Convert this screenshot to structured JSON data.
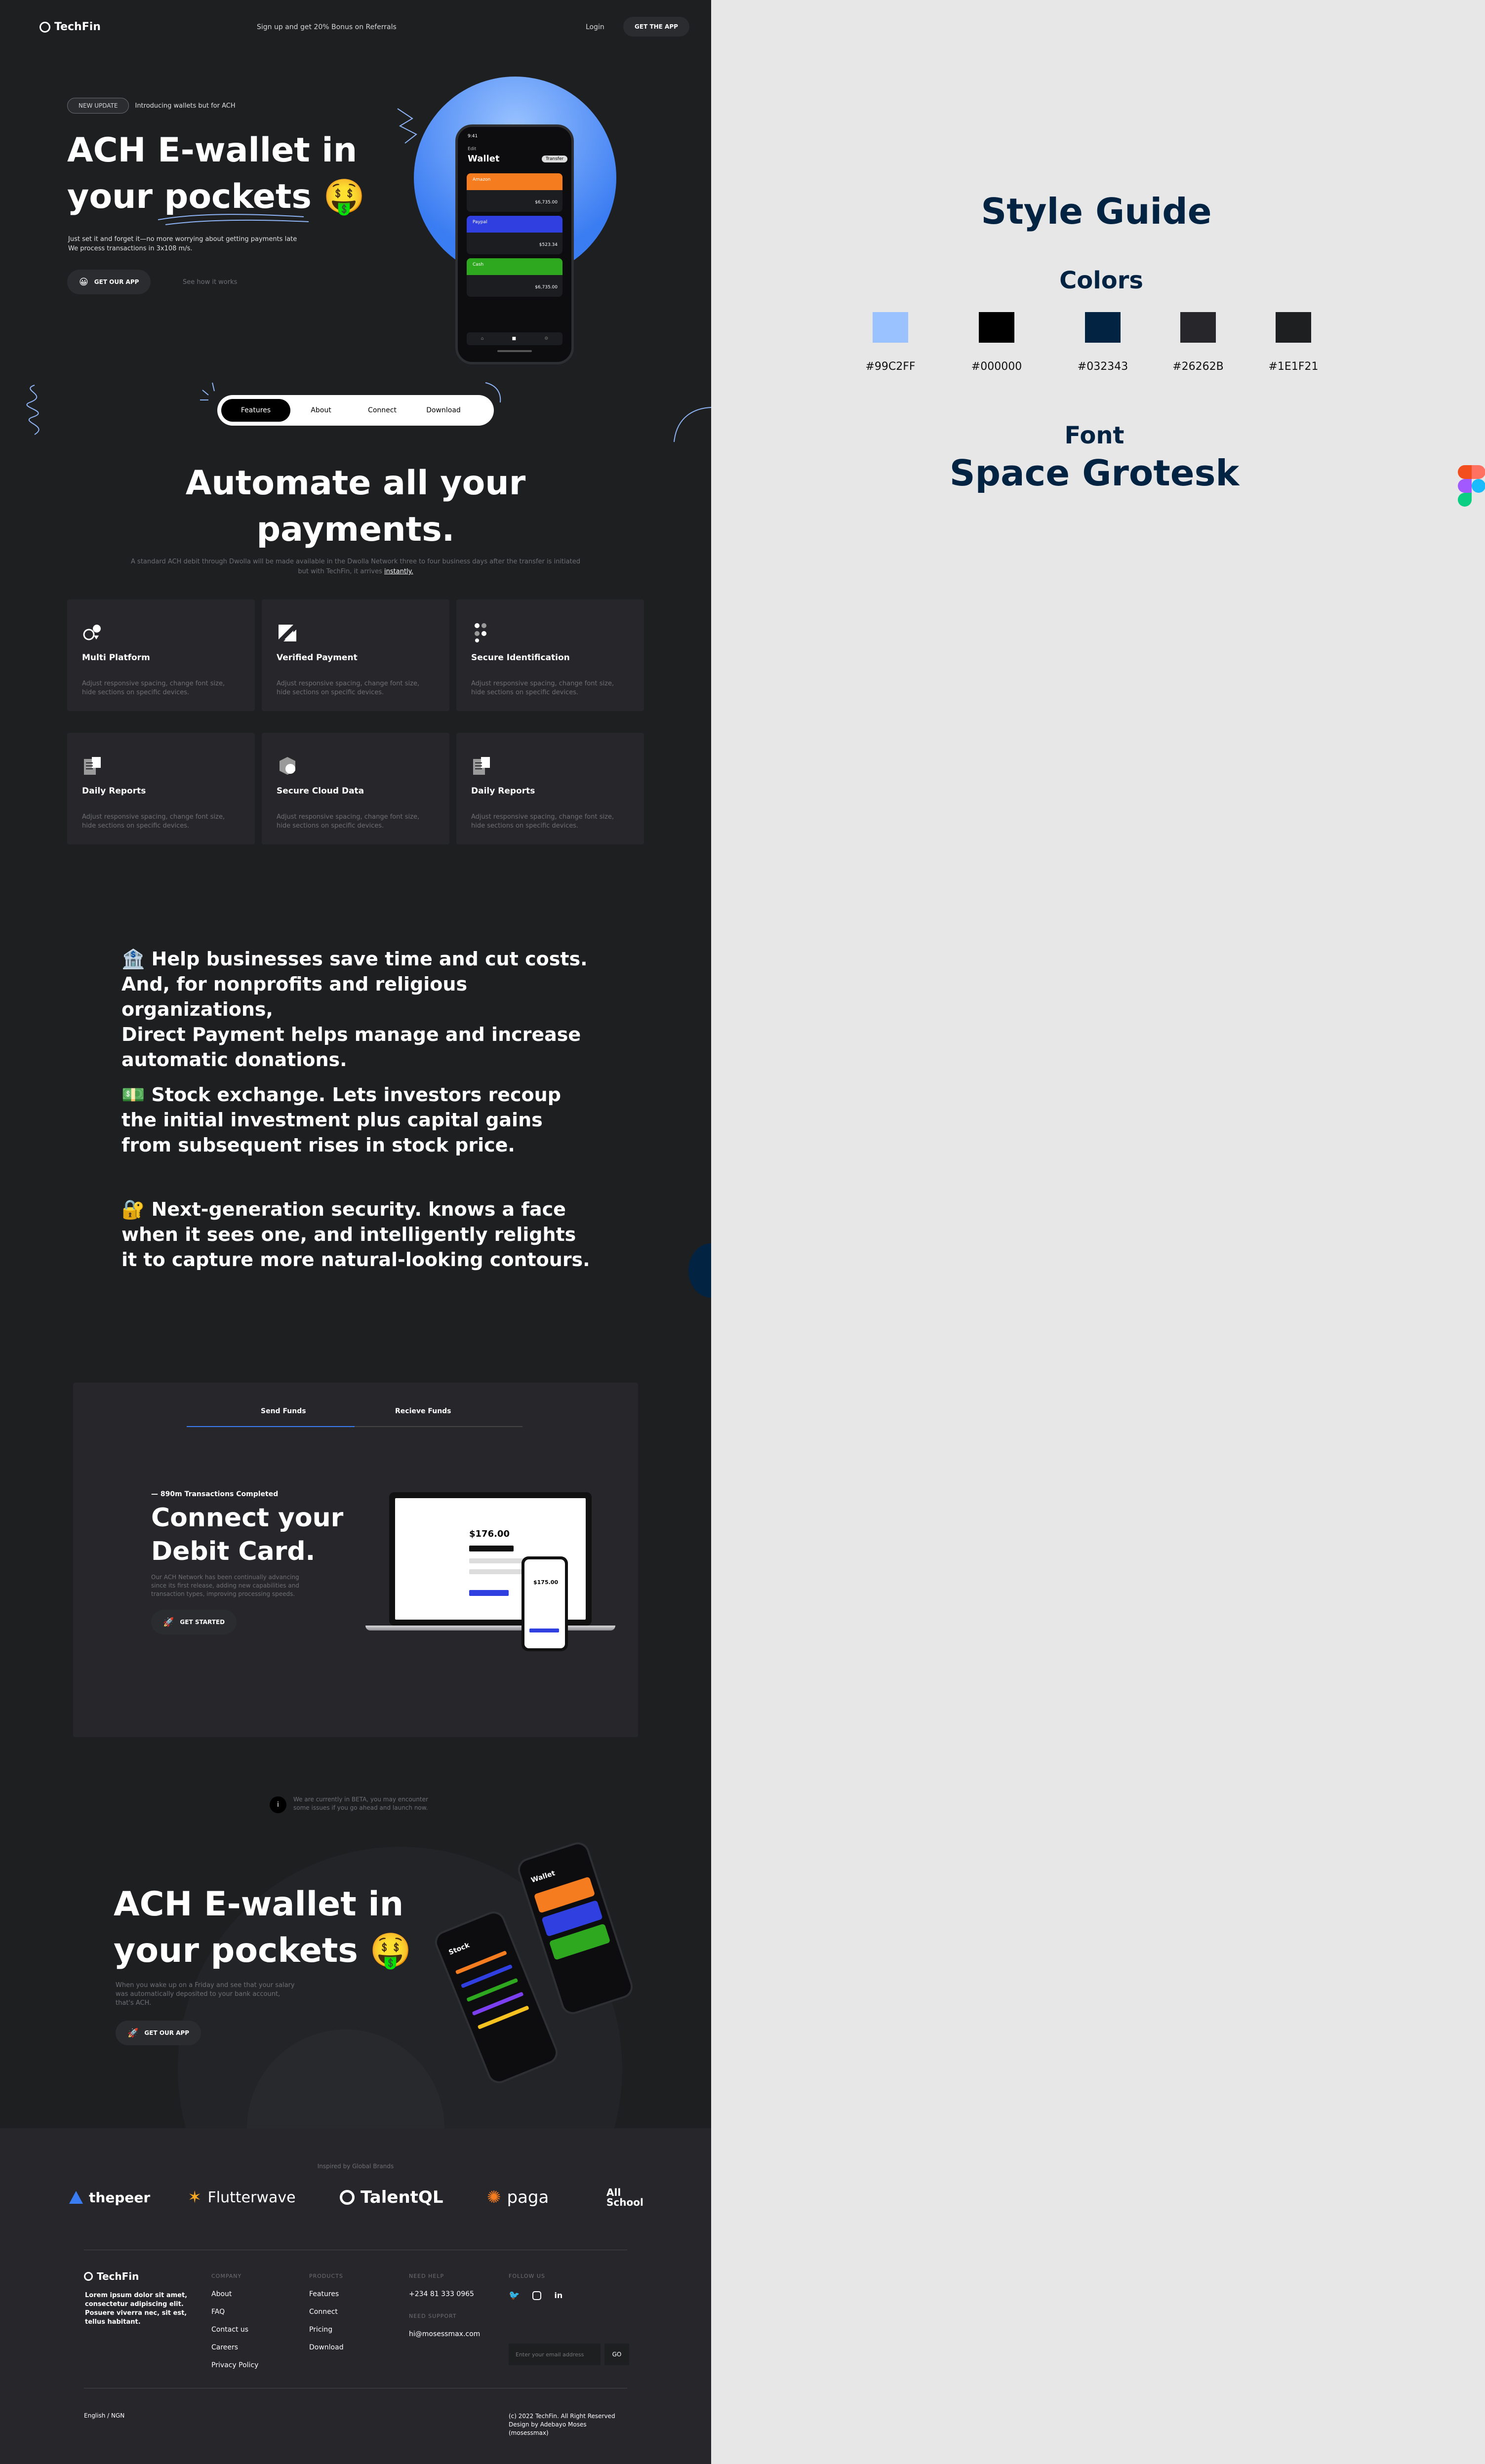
{
  "nav": {
    "logo": "TechFin",
    "promo": "Sign up and get 20% Bonus on Referrals",
    "login": "Login",
    "cta": "GET THE APP"
  },
  "hero": {
    "badge": "NEW UPDATE",
    "badge_text": "Introducing wallets but for ACH",
    "title_line1": "ACH E-wallet in",
    "title_line2": "your pockets",
    "emoji": "🤑",
    "desc_line1": "Just set it and forget it—no more worrying about getting payments late",
    "desc_line2": "We process transactions in 3x108 m/s.",
    "cta": "GET OUR APP",
    "secondary": "See how it works"
  },
  "phone": {
    "time": "9:41",
    "back": "Edit",
    "title": "Wallet",
    "action": "Transfer",
    "cards": [
      {
        "name": "Amazon",
        "amount": "$6,735.00",
        "color": "#f57c1f"
      },
      {
        "name": "Paypal",
        "amount": "$523.34",
        "color": "#2f3fe0"
      },
      {
        "name": "Cash",
        "amount": "$6,735.00",
        "color": "#2ea81e"
      }
    ]
  },
  "tabs": [
    "Features",
    "About",
    "Connect",
    "Download"
  ],
  "automate": {
    "title_line1": "Automate all your",
    "title_line2": "payments.",
    "sub_line1": "A standard ACH debit through Dwolla will be made available in the Dwolla Network three to four business days after the transfer is initiated",
    "sub_line2_pre": "but with TechFin, it arrives ",
    "sub_line2_em": "instantly."
  },
  "features": [
    {
      "title": "Multi Platform",
      "desc": "Adjust responsive spacing, change font size, hide sections on specific devices.",
      "icon": "multi-platform-icon"
    },
    {
      "title": "Verified Payment",
      "desc": "Adjust responsive spacing, change font size, hide sections on specific devices.",
      "icon": "verified-payment-icon"
    },
    {
      "title": "Secure Identification",
      "desc": "Adjust responsive spacing, change font size, hide sections on specific devices.",
      "icon": "secure-id-icon"
    },
    {
      "title": "Daily Reports",
      "desc": "Adjust responsive spacing, change font size, hide sections on specific devices.",
      "icon": "report-icon"
    },
    {
      "title": "Secure Cloud Data",
      "desc": "Adjust responsive spacing, change font size, hide sections on specific devices.",
      "icon": "cloud-data-icon"
    },
    {
      "title": "Daily Reports",
      "desc": "Adjust responsive spacing, change font size, hide sections on specific devices.",
      "icon": "report-icon"
    }
  ],
  "statements": [
    {
      "lines": [
        "🏦 Help businesses save time and cut costs.",
        "And, for nonprofits and religious organizations,",
        "Direct Payment helps manage and increase",
        "automatic donations."
      ]
    },
    {
      "lines": [
        "💵 Stock exchange. Lets investors recoup",
        "the initial investment plus capital gains",
        "from subsequent rises in stock price."
      ]
    },
    {
      "lines": [
        "🔐 Next-generation security. knows a face",
        "when it sees one, and intelligently relights",
        "it to capture more natural-looking contours."
      ]
    }
  ],
  "funds": {
    "tabs": [
      "Send Funds",
      "Recieve Funds"
    ],
    "kicker": "— 890m Transactions Completed",
    "title_line1": "Connect your",
    "title_line2": "Debit Card.",
    "desc_line1": "Our ACH Network has been continually advancing",
    "desc_line2": "since its first release, adding new capabilities and",
    "desc_line3": "transaction types, improving processing speeds.",
    "cta": "GET STARTED",
    "amount": "$176.00",
    "amount2": "$175.00"
  },
  "beta": {
    "line1": "We are currently in BETA, you may encounter",
    "line2": "some issues if you go ahead and launch now."
  },
  "hero2": {
    "title_line1": "ACH E-wallet in",
    "title_line2": "your pockets",
    "emoji": "🤑",
    "desc_line1": "When you wake up on a Friday and see that your salary",
    "desc_line2": "was automatically deposited to your bank account,",
    "desc_line3": "that's ACH.",
    "cta": "GET OUR APP",
    "stock": "Stock",
    "wallet": "Wallet"
  },
  "brands": {
    "caption": "Inspired by Global Brands",
    "items": [
      "thepeer",
      "Flutterwave",
      "TalentQL",
      "paga",
      "All School"
    ]
  },
  "footer": {
    "logo": "TechFin",
    "about_lines": [
      "Lorem ipsum dolor sit amet,",
      "consectetur adipiscing elit.",
      "Posuere viverra nec, sit est,",
      "tellus habitant."
    ],
    "company_h": "COMPANY",
    "company": [
      "About",
      "FAQ",
      "Contact us",
      "Careers",
      "Privacy Policy"
    ],
    "products_h": "PRODUCTS",
    "products": [
      "Features",
      "Connect",
      "Pricing",
      "Download"
    ],
    "help_h": "NEED HELP",
    "phone": "+234 81 333 0965",
    "support_h": "NEED SUPPORT",
    "email": "hi@mosessmax.com",
    "follow_h": "FOLLOW US",
    "email_placeholder": "Enter your email address",
    "go": "GO",
    "locale": "English / NGN",
    "copyright": "(c) 2022 TechFin. All Right Reserved",
    "credit_line1": "Design by Adebayo Moses",
    "credit_line2": "(mosessmax)"
  },
  "style_guide": {
    "title": "Style Guide",
    "colors_title": "Colors",
    "colors": [
      "#99C2FF",
      "#000000",
      "#032343",
      "#26262B",
      "#1E1F21"
    ],
    "font_title": "Font",
    "font_name": "Space Grotesk"
  }
}
